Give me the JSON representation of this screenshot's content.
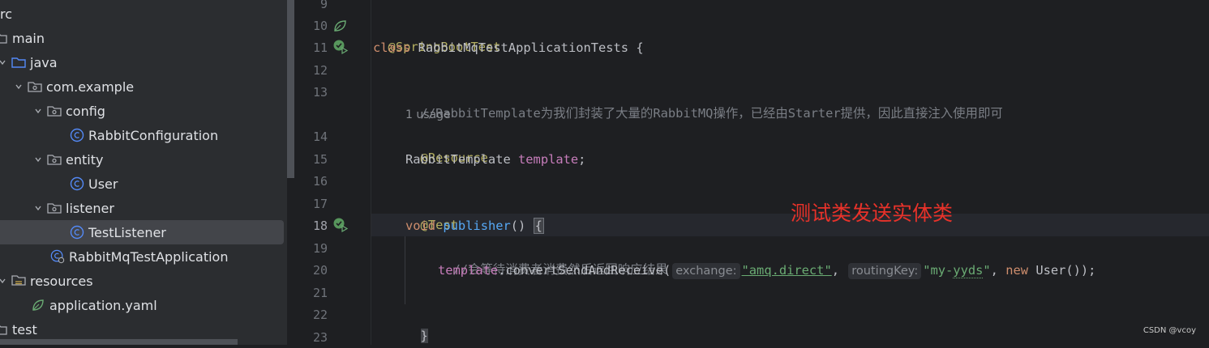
{
  "tree": {
    "items": [
      {
        "label": "rc",
        "icon": "folder-icon"
      },
      {
        "label": "main",
        "icon": "folder-icon"
      },
      {
        "label": "java",
        "icon": "source-folder-icon"
      },
      {
        "label": "com.example",
        "icon": "package-icon"
      },
      {
        "label": "config",
        "icon": "package-icon"
      },
      {
        "label": "RabbitConfiguration",
        "icon": "class-icon"
      },
      {
        "label": "entity",
        "icon": "package-icon"
      },
      {
        "label": "User",
        "icon": "class-icon"
      },
      {
        "label": "listener",
        "icon": "package-icon"
      },
      {
        "label": "TestListener",
        "icon": "class-icon"
      },
      {
        "label": "RabbitMqTestApplication",
        "icon": "spring-boot-class-icon"
      },
      {
        "label": "resources",
        "icon": "resources-folder-icon"
      },
      {
        "label": "application.yaml",
        "icon": "spring-config-icon"
      },
      {
        "label": "test",
        "icon": "folder-icon"
      }
    ]
  },
  "editor": {
    "line_numbers": [
      "9",
      "10",
      "11",
      "12",
      "13",
      "14",
      "15",
      "16",
      "17",
      "18",
      "19",
      "20",
      "21",
      "22",
      "23"
    ],
    "usage_hint": "1 usage",
    "lines": {
      "l10_annotation": "@SpringBootTest",
      "l11_keyword": "class",
      "l11_name": "RabbitMqTestApplicationTests",
      "l11_brace": "{",
      "l13_comment": "//RabbitTemplate为我们封装了大量的RabbitMQ操作，已经由Starter提供，因此直接注入使用即可",
      "l14_annotation": "@Resource",
      "l15_type": "RabbitTemplate",
      "l15_field": "template",
      "l15_semi": ";",
      "l17_annotation": "@Test",
      "l18_keyword": "void",
      "l18_method": "publisher",
      "l18_parens": "()",
      "l18_brace": "{",
      "l19_comment": "//会等待消费者消费然后返回响应结果",
      "l20_field": "template",
      "l20_call": ".convertSendAndReceive(",
      "l20_hint1": "exchange:",
      "l20_str1": "\"amq.direct\"",
      "l20_comma1": ",",
      "l20_hint2": "routingKey:",
      "l20_str2_a": "\"my-",
      "l20_str2_b": "yyds",
      "l20_str2_c": "\"",
      "l20_comma2": ",",
      "l20_new": "new",
      "l20_tail": "User());",
      "l22_brace": "}"
    }
  },
  "annotation_text": "测试类发送实体类",
  "watermark": "CSDN @vcoy",
  "colors": {
    "background": "#1e1f22",
    "tree_bg": "#2b2d30",
    "annotation_red": "#e8322a",
    "keyword": "#cf8e6d",
    "string": "#6aab73"
  }
}
